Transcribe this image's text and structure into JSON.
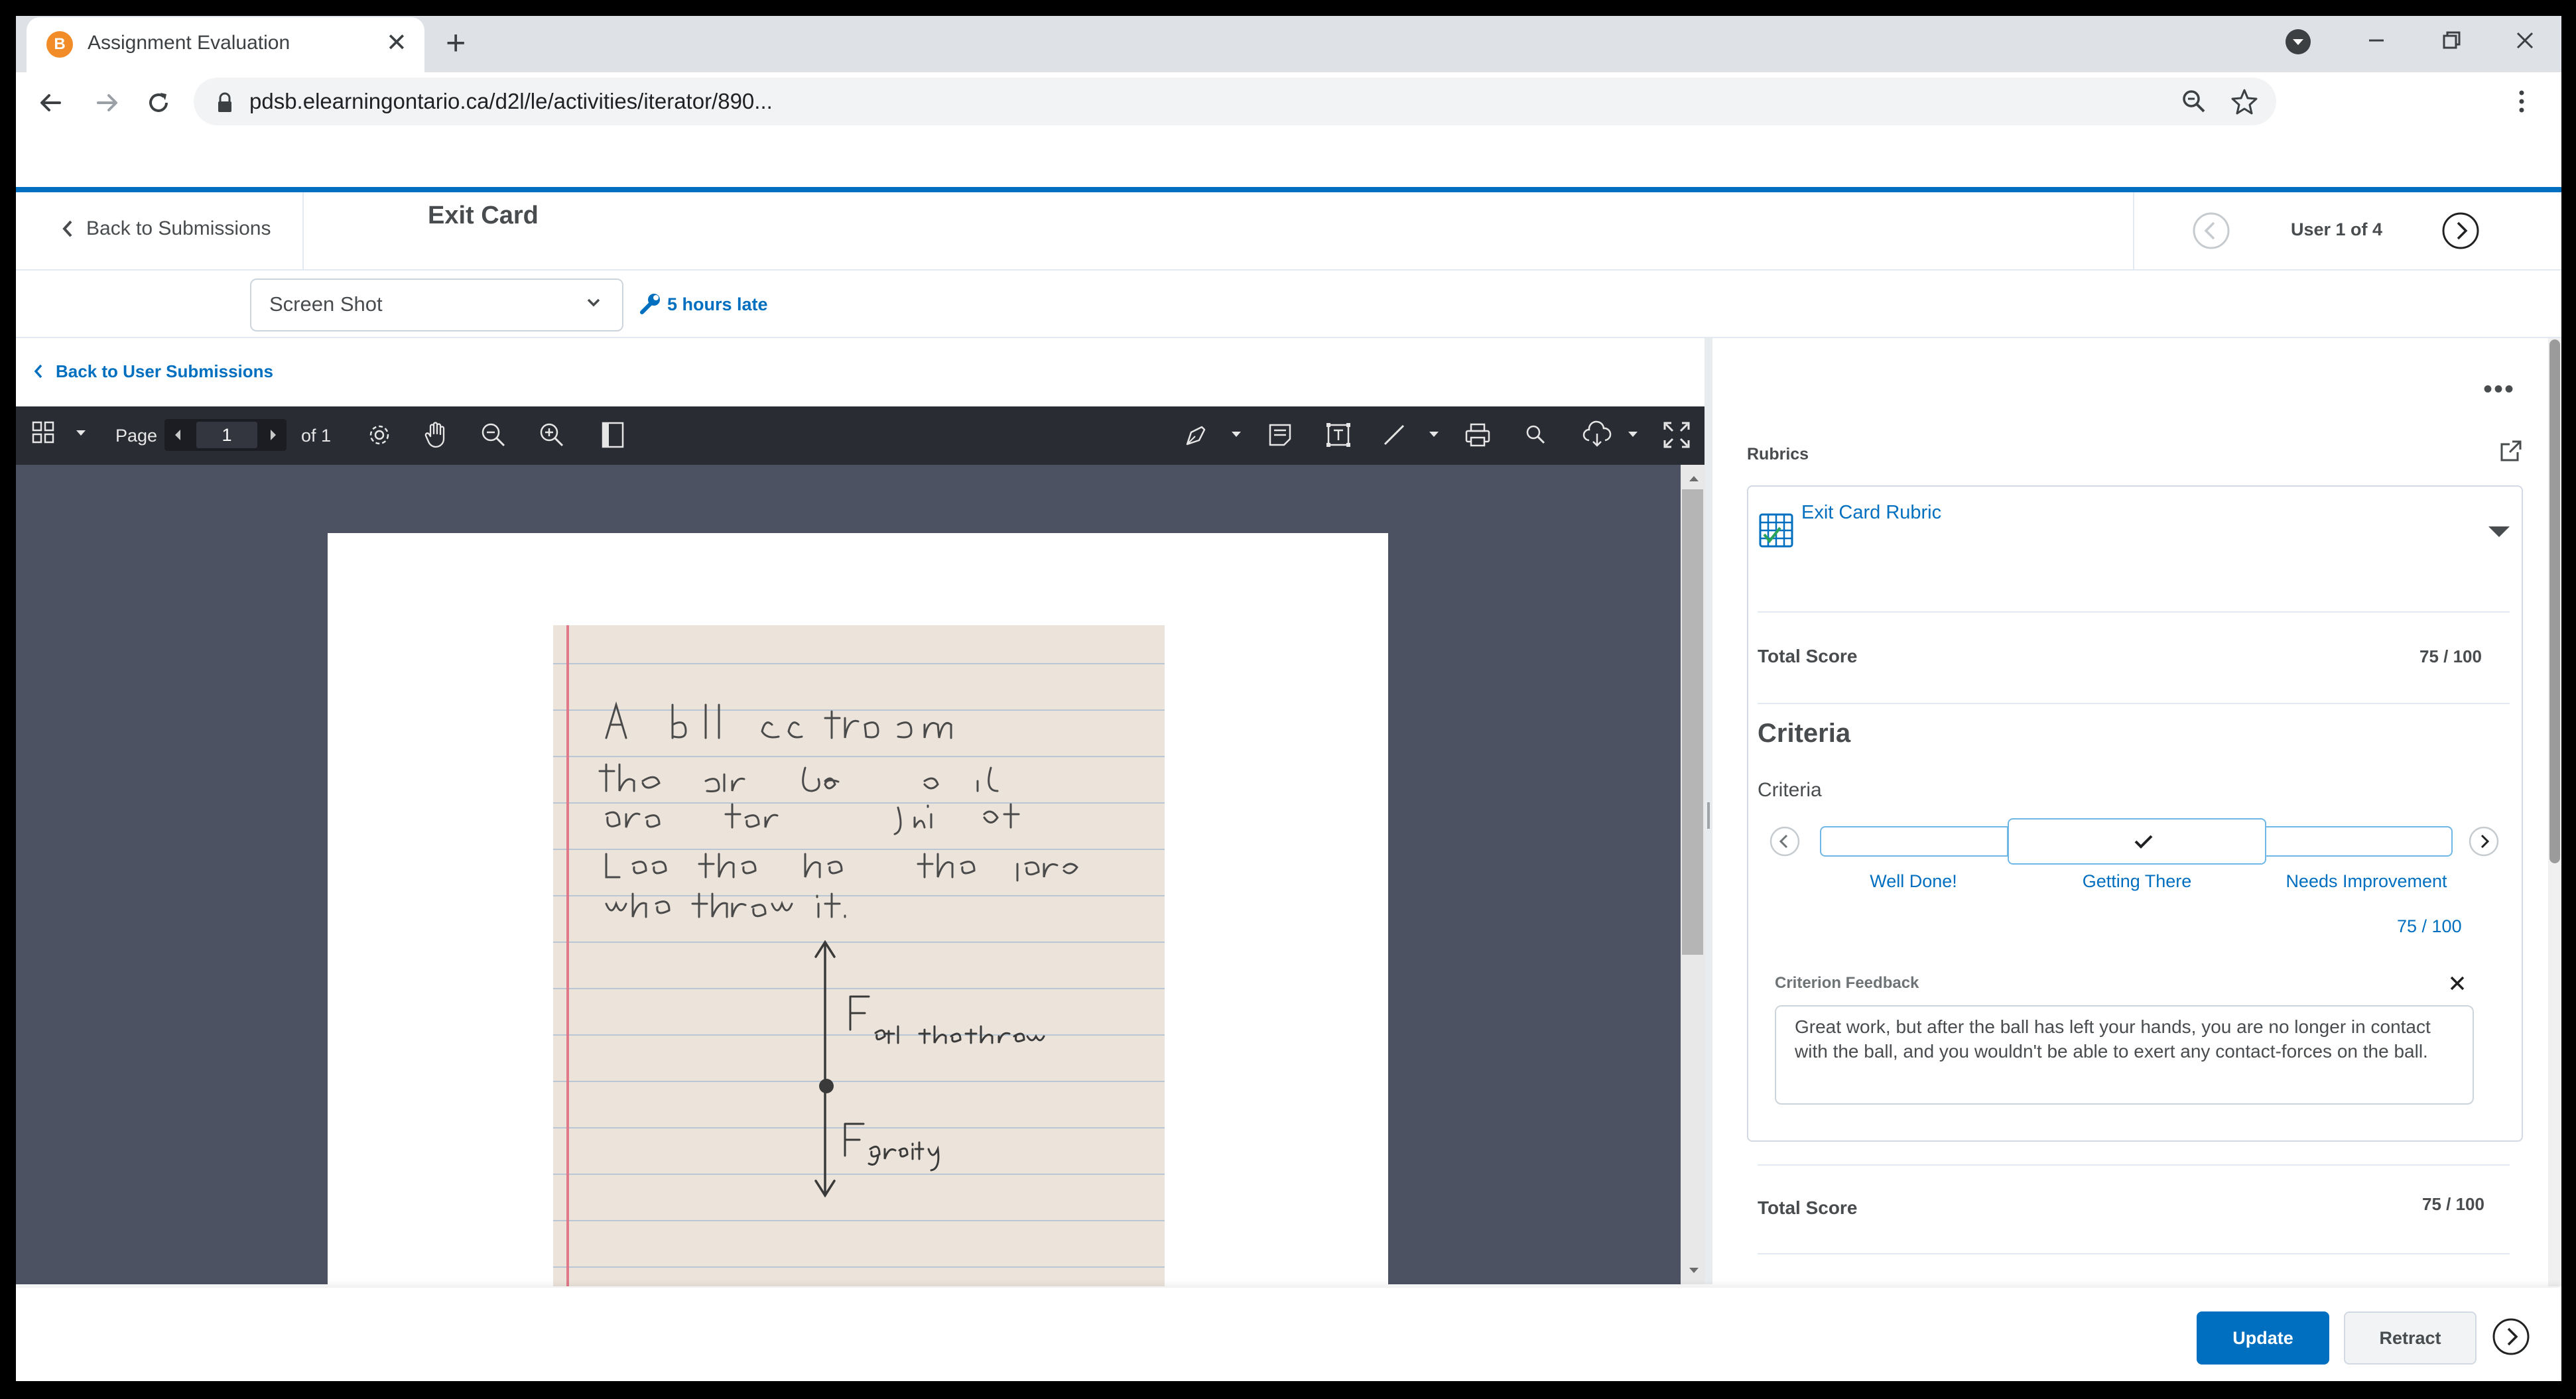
{
  "browser": {
    "tab_title": "Assignment Evaluation",
    "favicon_letter": "B",
    "url": "pdsb.elearningontario.ca/d2l/le/activities/iterator/890..."
  },
  "header": {
    "back_label": "Back to Submissions",
    "title": "Exit Card",
    "user_count": "User 1 of 4"
  },
  "submission": {
    "file_selected": "Screen Shot",
    "late_label": "5 hours late",
    "back_user_label": "Back to User Submissions"
  },
  "viewer": {
    "page_label": "Page",
    "page_value": "1",
    "of_label": "of 1"
  },
  "rubric": {
    "section_label": "Rubrics",
    "name": "Exit Card Rubric",
    "total_label": "Total Score",
    "total_value": "75 / 100",
    "criteria_heading": "Criteria",
    "criteria_sub": "Criteria",
    "levels": [
      {
        "label": "Well Done!",
        "selected": false
      },
      {
        "label": "Getting There",
        "selected": true
      },
      {
        "label": "Needs Improvement",
        "selected": false
      }
    ],
    "criterion_score": "75 / 100",
    "feedback_label": "Criterion Feedback",
    "feedback_text": "Great work, but after the ball has left your hands, you are no longer in contact with the ball, and you wouldn't be able to exert any contact-forces on the ball.",
    "total2_label": "Total Score",
    "total2_value": "75 / 100"
  },
  "footer": {
    "update_label": "Update",
    "retract_label": "Retract"
  },
  "colors": {
    "accent": "#006fbf",
    "viewer_toolbar": "#2a2c33",
    "viewer_bg": "#4c5261"
  }
}
